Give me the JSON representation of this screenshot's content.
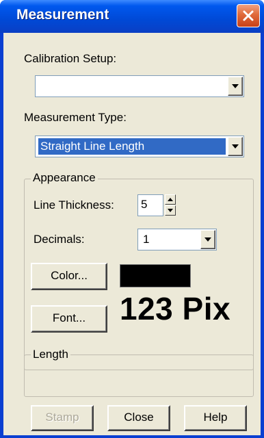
{
  "window": {
    "title": "Measurement",
    "close_label": "close"
  },
  "calibration": {
    "label": "Calibration Setup:",
    "value": ""
  },
  "measurement_type": {
    "label": "Measurement Type:",
    "value": "Straight Line Length"
  },
  "appearance": {
    "legend": "Appearance",
    "line_thickness_label": "Line Thickness:",
    "line_thickness_value": "5",
    "decimals_label": "Decimals:",
    "decimals_value": "1",
    "color_button": "Color...",
    "color_value": "#000000",
    "font_button": "Font...",
    "font_sample": "123 Pix"
  },
  "length": {
    "legend": "Length",
    "value": ""
  },
  "buttons": {
    "stamp": "Stamp",
    "close": "Close",
    "help": "Help"
  },
  "colors": {
    "title_bar": "#0049d6",
    "dialog_bg": "#ece9d8",
    "selection": "#316ac5",
    "close_button": "#e06a3a"
  }
}
